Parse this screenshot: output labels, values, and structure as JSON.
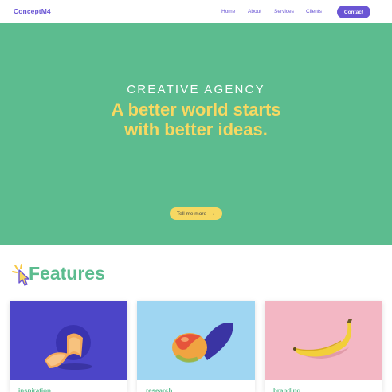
{
  "nav": {
    "brand": "ConceptM4",
    "links": [
      "Home",
      "About",
      "Services",
      "Clients"
    ],
    "contact_label": "Contact"
  },
  "hero": {
    "eyebrow": "CREATIVE AGENCY",
    "title_line1": "A better world starts",
    "title_line2": "with better ideas.",
    "cta_label": "Tell me more",
    "cta_icon": "arrow-right-icon"
  },
  "features": {
    "title": "Features",
    "icon": "cursor-click-icon",
    "cards": [
      {
        "label": "inspiration",
        "image": "melon-image"
      },
      {
        "label": "research",
        "image": "mango-image"
      },
      {
        "label": "branding",
        "image": "banana-image"
      }
    ]
  },
  "colors": {
    "brand_purple": "#6a55d4",
    "hero_green": "#5cbc8f",
    "accent_yellow": "#f7d862",
    "card_blue": "#4c45c8",
    "card_sky": "#9fd6f2",
    "card_pink": "#f3b7c4"
  }
}
